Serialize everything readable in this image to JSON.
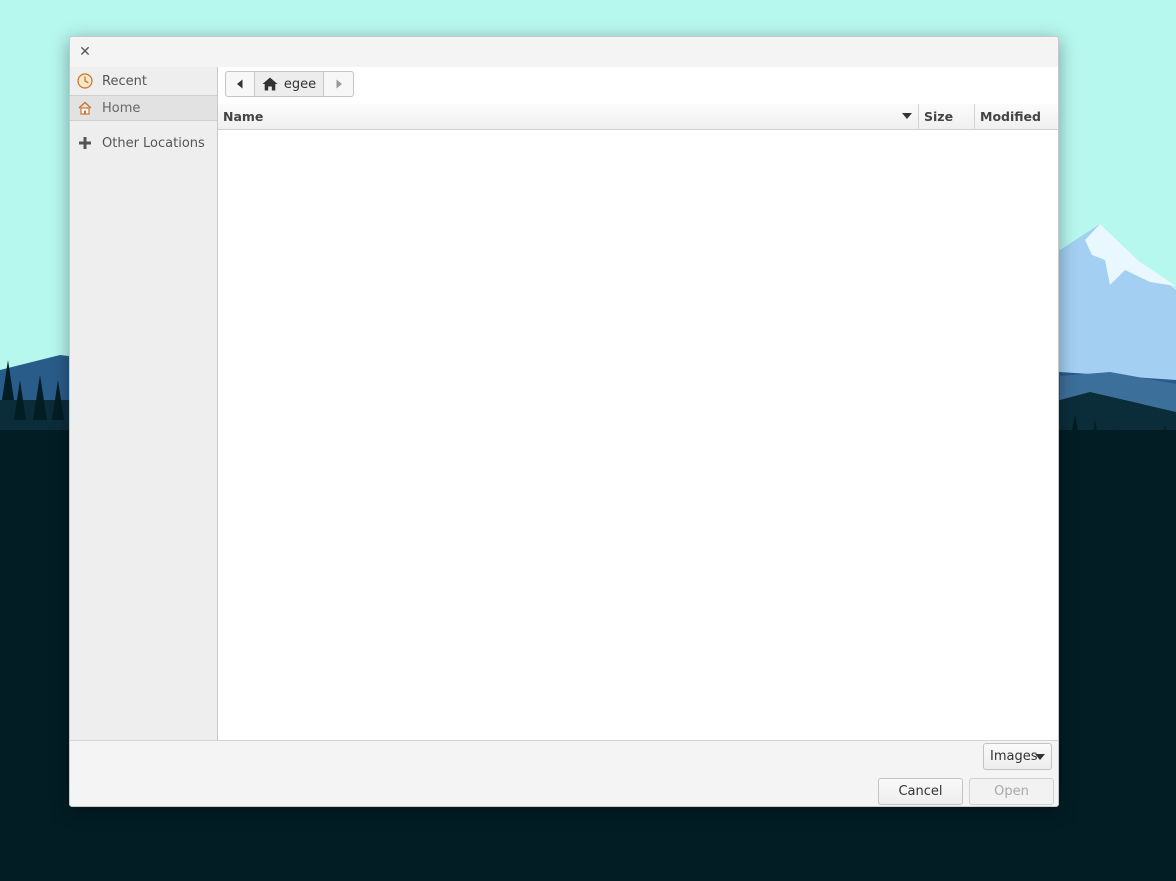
{
  "sidebar": {
    "items": [
      {
        "label": "Recent",
        "icon": "recent-clock-icon"
      },
      {
        "label": "Home",
        "icon": "home-icon",
        "selected": true
      },
      {
        "label": "Other Locations",
        "icon": "plus-icon"
      }
    ]
  },
  "pathbar": {
    "current_folder": "egee",
    "back_icon": "chevron-left-icon",
    "forward_icon": "chevron-right-icon"
  },
  "columns": {
    "name": "Name",
    "size": "Size",
    "modified": "Modified"
  },
  "filter": {
    "selected": "Images"
  },
  "buttons": {
    "cancel": "Cancel",
    "open": "Open"
  },
  "colors": {
    "sky": "#b6f7ee",
    "accent_icon": "#c8752e"
  }
}
